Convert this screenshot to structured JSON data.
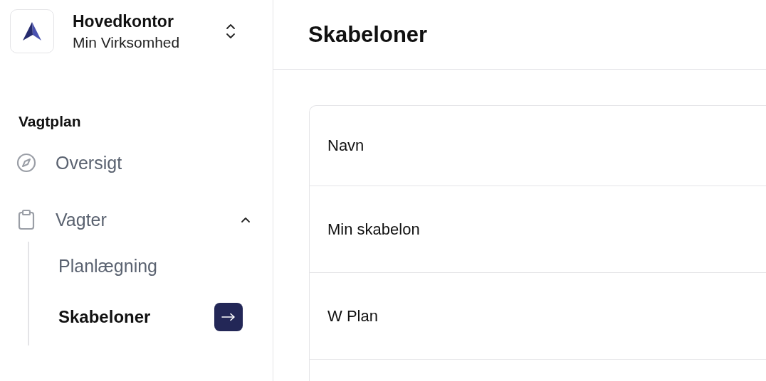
{
  "workspace": {
    "name": "Hovedkontor",
    "organization": "Min Virksomhed"
  },
  "sidebar": {
    "section_title": "Vagtplan",
    "items": [
      {
        "label": "Oversigt"
      },
      {
        "label": "Vagter",
        "expanded": true,
        "children": [
          {
            "label": "Planlægning",
            "selected": false
          },
          {
            "label": "Skabeloner",
            "selected": true
          }
        ]
      }
    ]
  },
  "page_title": "Skabeloner",
  "table": {
    "columns": [
      "Navn"
    ],
    "rows": [
      {
        "name": "Min skabelon"
      },
      {
        "name": "W Plan"
      }
    ]
  }
}
